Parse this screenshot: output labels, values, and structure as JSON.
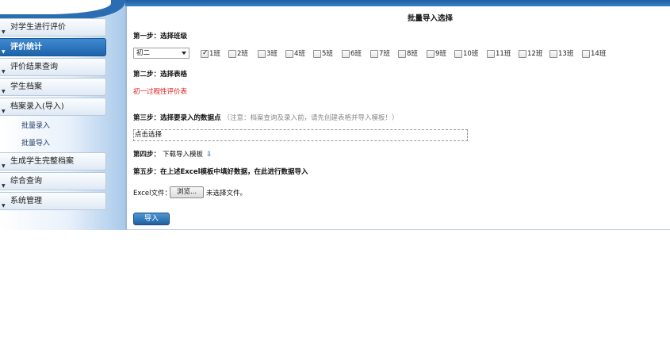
{
  "sidebar": {
    "items": [
      {
        "label": "对学生进行评价",
        "active": false
      },
      {
        "label": "评价统计",
        "active": true
      },
      {
        "label": "评价结果查询",
        "active": false
      },
      {
        "label": "学生档案",
        "active": false
      },
      {
        "label": "档案录入(导入)",
        "active": false
      }
    ],
    "subitems": [
      {
        "label": "批量录入"
      },
      {
        "label": "批量导入"
      }
    ],
    "items_after": [
      {
        "label": "生成学生完整档案"
      },
      {
        "label": "综合查询"
      },
      {
        "label": "系统管理"
      }
    ],
    "bullet": "▼"
  },
  "main": {
    "title": "批量导入选择",
    "step1": "第一步：选择班级",
    "grade_select": "初二",
    "classes": [
      {
        "label": "1班",
        "checked": true
      },
      {
        "label": "2班",
        "checked": false
      },
      {
        "label": "3班",
        "checked": false
      },
      {
        "label": "4班",
        "checked": false
      },
      {
        "label": "5班",
        "checked": false
      },
      {
        "label": "6班",
        "checked": false
      },
      {
        "label": "7班",
        "checked": false
      },
      {
        "label": "8班",
        "checked": false
      },
      {
        "label": "9班",
        "checked": false
      },
      {
        "label": "10班",
        "checked": false
      },
      {
        "label": "11班",
        "checked": false
      },
      {
        "label": "12班",
        "checked": false
      },
      {
        "label": "13班",
        "checked": false
      },
      {
        "label": "14班",
        "checked": false
      }
    ],
    "step2": "第二步：选择表格",
    "table_link": "初一过程性评价表",
    "step3": "第三步：选择要录入的数据点",
    "step3_note": "（注意：档案查询及录入前，请先创建表格并导入模板！）",
    "picker_text": "点击选择",
    "step4": "第四步：",
    "step4_link": "下载导入模板",
    "step5": "第五步：在上述Excel模板中填好数据，在此进行数据导入",
    "file_label": "Excel文件：",
    "browse_label": "浏览...",
    "file_status": "未选择文件。",
    "import_label": "导入"
  },
  "colors": {
    "accent": "#1e63aa",
    "link_red": "#e02020",
    "note_gray": "#888888"
  }
}
